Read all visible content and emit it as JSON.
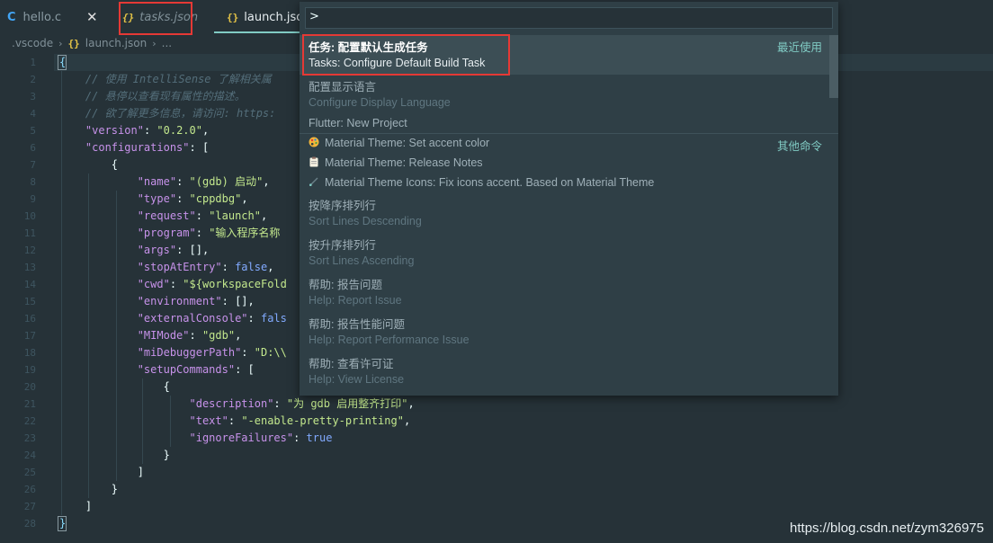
{
  "tabs": [
    {
      "label": "hello.c",
      "icon": "c-icon"
    },
    {
      "label": "tasks.json",
      "icon": "json-braces-icon"
    },
    {
      "label": "launch.json",
      "icon": "json-braces-icon"
    }
  ],
  "tab_icon_text": {
    "c": "C",
    "braces": "{}"
  },
  "close_glyph": "✕",
  "breadcrumb": {
    "folder": ".vscode",
    "file": "launch.json",
    "trail": "..."
  },
  "palette": {
    "input_value": ">",
    "items": [
      {
        "title": "任务: 配置默认生成任务",
        "subtitle": "Tasks: Configure Default Build Task",
        "right": "最近使用",
        "selected": true
      },
      {
        "title": "配置显示语言",
        "subtitle": "Configure Display Language"
      },
      {
        "title": "Flutter: New Project"
      },
      {
        "title": "Material Theme: Set accent color",
        "icon": "palette-icon",
        "right": "其他命令"
      },
      {
        "title": "Material Theme: Release Notes",
        "icon": "clipboard-icon"
      },
      {
        "title": "Material Theme Icons: Fix icons accent. Based on Material Theme",
        "icon": "paintbrush-icon"
      },
      {
        "title": "按降序排列行",
        "subtitle": "Sort Lines Descending"
      },
      {
        "title": "按升序排列行",
        "subtitle": "Sort Lines Ascending"
      },
      {
        "title": "帮助: 报告问题",
        "subtitle": "Help: Report Issue"
      },
      {
        "title": "帮助: 报告性能问题",
        "subtitle": "Help: Report Performance Issue"
      },
      {
        "title": "帮助: 查看许可证",
        "subtitle": "Help: View License"
      }
    ]
  },
  "editor": {
    "line_numbers": [
      "1",
      "2",
      "3",
      "4",
      "5",
      "6",
      "7",
      "8",
      "9",
      "10",
      "11",
      "12",
      "13",
      "14",
      "15",
      "16",
      "17",
      "18",
      "19",
      "20",
      "21",
      "22",
      "23",
      "24",
      "25",
      "26",
      "27",
      "28"
    ],
    "lines": [
      [
        [
          "{",
          "punc"
        ]
      ],
      [
        [
          "    // 使用 IntelliSense 了解相关属",
          "com"
        ]
      ],
      [
        [
          "    // 悬停以查看现有属性的描述。",
          "com"
        ]
      ],
      [
        [
          "    // 欲了解更多信息，请访问: https:",
          "com"
        ]
      ],
      [
        [
          "    ",
          ""
        ],
        [
          "\"version\"",
          "key"
        ],
        [
          ": ",
          ""
        ],
        [
          "\"0.2.0\"",
          "str"
        ],
        [
          ",",
          ""
        ]
      ],
      [
        [
          "    ",
          ""
        ],
        [
          "\"configurations\"",
          "key"
        ],
        [
          ": [",
          ""
        ]
      ],
      [
        [
          "        {",
          ""
        ]
      ],
      [
        [
          "            ",
          ""
        ],
        [
          "\"name\"",
          "key"
        ],
        [
          ": ",
          ""
        ],
        [
          "\"(gdb) 启动\"",
          "str"
        ],
        [
          ",",
          ""
        ]
      ],
      [
        [
          "            ",
          ""
        ],
        [
          "\"type\"",
          "key"
        ],
        [
          ": ",
          ""
        ],
        [
          "\"cppdbg\"",
          "str"
        ],
        [
          ",",
          ""
        ]
      ],
      [
        [
          "            ",
          ""
        ],
        [
          "\"request\"",
          "key"
        ],
        [
          ": ",
          ""
        ],
        [
          "\"launch\"",
          "str"
        ],
        [
          ",",
          ""
        ]
      ],
      [
        [
          "            ",
          ""
        ],
        [
          "\"program\"",
          "key"
        ],
        [
          ": ",
          ""
        ],
        [
          "\"输入程序名称",
          "str"
        ]
      ],
      [
        [
          "            ",
          ""
        ],
        [
          "\"args\"",
          "key"
        ],
        [
          ": [],",
          ""
        ]
      ],
      [
        [
          "            ",
          ""
        ],
        [
          "\"stopAtEntry\"",
          "key"
        ],
        [
          ": ",
          ""
        ],
        [
          "false",
          "kw"
        ],
        [
          ",",
          ""
        ]
      ],
      [
        [
          "            ",
          ""
        ],
        [
          "\"cwd\"",
          "key"
        ],
        [
          ": ",
          ""
        ],
        [
          "\"${workspaceFold",
          "str"
        ]
      ],
      [
        [
          "            ",
          ""
        ],
        [
          "\"environment\"",
          "key"
        ],
        [
          ": [],",
          ""
        ]
      ],
      [
        [
          "            ",
          ""
        ],
        [
          "\"externalConsole\"",
          "key"
        ],
        [
          ": ",
          ""
        ],
        [
          "fals",
          "kw"
        ]
      ],
      [
        [
          "            ",
          ""
        ],
        [
          "\"MIMode\"",
          "key"
        ],
        [
          ": ",
          ""
        ],
        [
          "\"gdb\"",
          "str"
        ],
        [
          ",",
          ""
        ]
      ],
      [
        [
          "            ",
          ""
        ],
        [
          "\"miDebuggerPath\"",
          "key"
        ],
        [
          ": ",
          ""
        ],
        [
          "\"D:\\\\",
          "str"
        ]
      ],
      [
        [
          "            ",
          ""
        ],
        [
          "\"setupCommands\"",
          "key"
        ],
        [
          ": [",
          ""
        ]
      ],
      [
        [
          "                {",
          ""
        ]
      ],
      [
        [
          "                    ",
          ""
        ],
        [
          "\"description\"",
          "key"
        ],
        [
          ": ",
          ""
        ],
        [
          "\"为 gdb 启用整齐打印\"",
          "str"
        ],
        [
          ",",
          ""
        ]
      ],
      [
        [
          "                    ",
          ""
        ],
        [
          "\"text\"",
          "key"
        ],
        [
          ": ",
          ""
        ],
        [
          "\"-enable-pretty-printing\"",
          "str"
        ],
        [
          ",",
          ""
        ]
      ],
      [
        [
          "                    ",
          ""
        ],
        [
          "\"ignoreFailures\"",
          "key"
        ],
        [
          ": ",
          ""
        ],
        [
          "true",
          "kw"
        ]
      ],
      [
        [
          "                }",
          ""
        ]
      ],
      [
        [
          "            ]",
          ""
        ]
      ],
      [
        [
          "        }",
          ""
        ]
      ],
      [
        [
          "    ]",
          ""
        ]
      ],
      [
        [
          "}",
          "punc"
        ]
      ]
    ]
  },
  "watermark": "https://blog.csdn.net/zym326975"
}
